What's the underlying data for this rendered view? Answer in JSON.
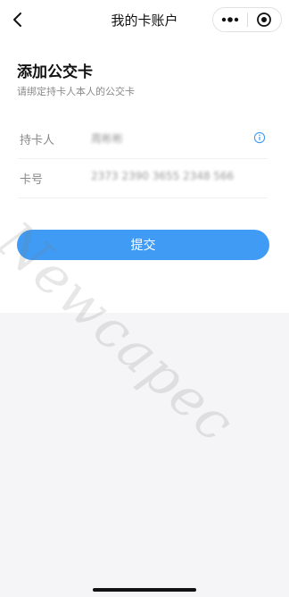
{
  "nav": {
    "title": "我的卡账户",
    "back_icon": "chevron-left-icon",
    "more_icon": "more-icon",
    "close_icon": "target-icon"
  },
  "form": {
    "title": "添加公交卡",
    "subtitle": "请绑定持卡人本人的公交卡",
    "fields": [
      {
        "label": "持卡人",
        "value": "周彬彬",
        "info_icon": "info-icon"
      },
      {
        "label": "卡号",
        "value": "2373 2390 3655 2348 566"
      }
    ],
    "submit_label": "提交"
  },
  "watermark": "Newcapec",
  "colors": {
    "accent": "#3f9bf4",
    "background": "#f5f5f7"
  }
}
